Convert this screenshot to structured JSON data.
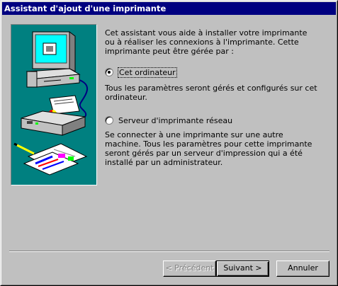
{
  "window": {
    "title": "Assistant d'ajout d'une imprimante"
  },
  "content": {
    "intro": "Cet assistant vous aide à installer votre imprimante ou à réaliser les connexions à l'imprimante. Cette imprimante peut être gérée par :",
    "option_local": {
      "label": "Cet ordinateur",
      "selected": true,
      "description": "Tous les paramètres seront gérés et configurés sur cet ordinateur."
    },
    "option_network": {
      "label": "Serveur d'imprimante réseau",
      "selected": false,
      "description": "Se connecter à une imprimante sur une autre machine. Tous les paramètres pour cette imprimante seront gérés par un serveur d'impression qui a été installé par un administrateur."
    }
  },
  "buttons": {
    "back": "< Précédent",
    "next": "Suivant >",
    "cancel": "Annuler"
  },
  "colors": {
    "titlebar": "#000080",
    "illustration_bg": "#008080",
    "face": "#c0c0c0"
  },
  "icons": {
    "illustration": "computer-printer-illustration"
  }
}
